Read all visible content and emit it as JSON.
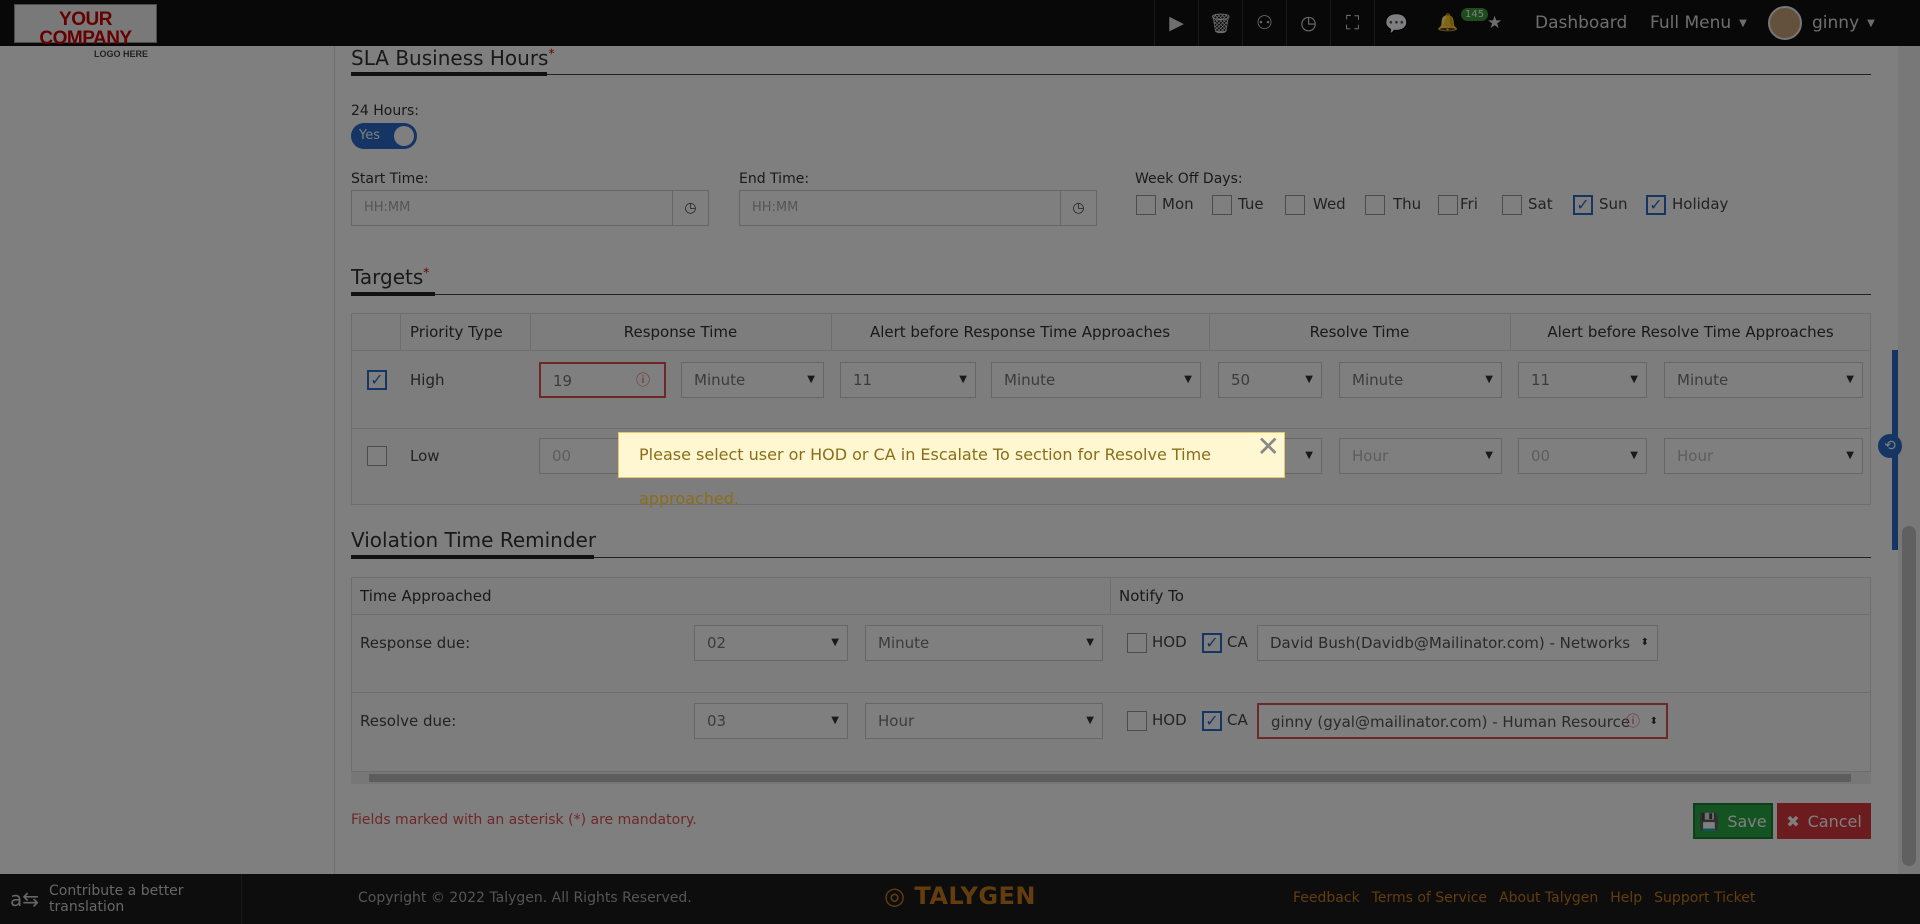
{
  "topbar": {
    "logo_line1": "YOUR COMPANY",
    "logo_line2": "LOGO HERE",
    "notification_count": "145",
    "dashboard": "Dashboard",
    "full_menu": "Full Menu",
    "user": "ginny"
  },
  "sla": {
    "title": "SLA Business Hours",
    "hours_label": "24 Hours:",
    "hours_toggle": "Yes",
    "start_label": "Start Time:",
    "start_placeholder": "HH:MM",
    "end_label": "End Time:",
    "end_placeholder": "HH:MM",
    "weekoff_label": "Week Off Days:",
    "days": [
      {
        "label": "Mon",
        "checked": false
      },
      {
        "label": "Tue",
        "checked": false
      },
      {
        "label": "Wed",
        "checked": false
      },
      {
        "label": "Thu",
        "checked": false
      },
      {
        "label": "Fri",
        "checked": false
      },
      {
        "label": "Sat",
        "checked": false
      },
      {
        "label": "Sun",
        "checked": true
      },
      {
        "label": "Holiday",
        "checked": true
      }
    ]
  },
  "targets": {
    "title": "Targets",
    "headers": [
      "Priority Type",
      "Response Time",
      "Alert before Response Time Approaches",
      "Resolve Time",
      "Alert before Resolve Time Approaches"
    ],
    "rows": [
      {
        "priority": "High",
        "checked": true,
        "response": "19",
        "response_unit": "Minute",
        "alert_resp": "11",
        "alert_resp_unit": "Minute",
        "resolve": "50",
        "resolve_unit": "Minute",
        "alert_res": "11",
        "alert_res_unit": "Minute"
      },
      {
        "priority": "Low",
        "checked": false,
        "response": "00",
        "response_unit": "",
        "alert_resp": "",
        "alert_resp_unit": "",
        "resolve": "",
        "resolve_unit": "Hour",
        "alert_res": "00",
        "alert_res_unit": "Hour"
      }
    ]
  },
  "violation": {
    "title": "Violation Time Reminder",
    "col_time": "Time Approached",
    "col_notify": "Notify To",
    "rows": [
      {
        "label": "Response due:",
        "value": "02",
        "unit": "Minute",
        "hod": "HOD",
        "ca": "CA",
        "hod_checked": false,
        "ca_checked": true,
        "user": "David Bush(Davidb@Mailinator.com) - Networks"
      },
      {
        "label": "Resolve due:",
        "value": "03",
        "unit": "Hour",
        "hod": "HOD",
        "ca": "CA",
        "hod_checked": false,
        "ca_checked": true,
        "user": "ginny  (gyal@mailinator.com) - Human Resource"
      }
    ]
  },
  "mandatory_note": "Fields marked with an asterisk (*) are mandatory.",
  "save_label": "Save",
  "cancel_label": "Cancel",
  "toast": "Please select user or HOD or CA in Escalate To section for Resolve Time approached.",
  "footer": {
    "translate": "Contribute a better translation",
    "copyright": "Copyright © 2022 Talygen. All Rights Reserved.",
    "brand": "TALYGEN",
    "links": [
      "Feedback",
      "Terms of Service",
      "About Talygen",
      "Help",
      "Support Ticket"
    ]
  },
  "colors": {
    "accent": "#2a6cc8",
    "save": "#28a745",
    "cancel": "#d9363e",
    "error": "#d9534f",
    "brand": "#c77b1a"
  }
}
